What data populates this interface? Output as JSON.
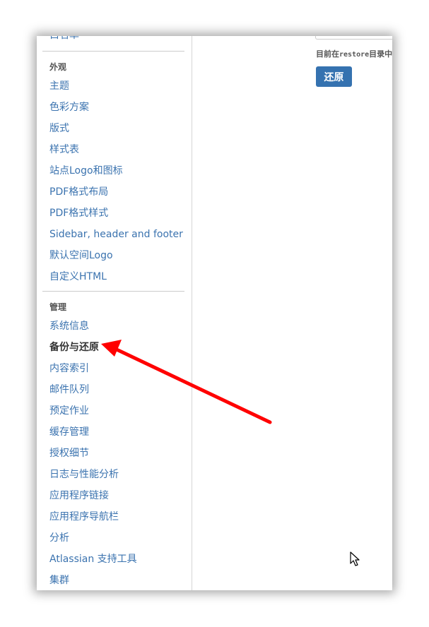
{
  "sidebar": {
    "cut_item": "白名单",
    "sections": [
      {
        "title": "外观",
        "items": [
          "主题",
          "色彩方案",
          "版式",
          "样式表",
          "站点Logo和图标",
          "PDF格式布局",
          "PDF格式样式",
          "Sidebar, header and footer",
          "默认空间Logo",
          "自定义HTML"
        ]
      },
      {
        "title": "管理",
        "items": [
          "系统信息",
          "备份与还原",
          "内容索引",
          "邮件队列",
          "预定作业",
          "缓存管理",
          "授权细节",
          "日志与性能分析",
          "应用程序链接",
          "应用程序导航栏",
          "分析",
          "Atlassian 支持工具",
          "集群"
        ]
      }
    ],
    "active_item": "备份与还原"
  },
  "main": {
    "info_prefix": "目前在",
    "info_dir": "restore",
    "info_suffix": "目录中",
    "restore_button": "还原"
  },
  "annotation": {
    "arrow_color": "#ff0000",
    "pointer": "mouse-cursor-icon"
  }
}
